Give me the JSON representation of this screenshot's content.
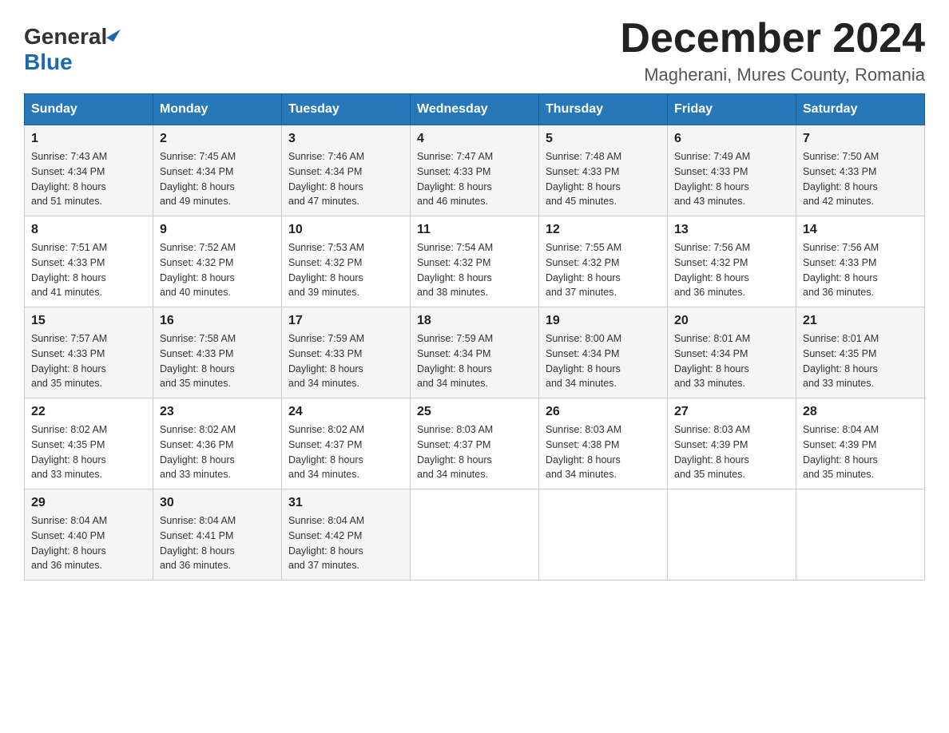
{
  "header": {
    "logo_general": "General",
    "logo_blue": "Blue",
    "month_title": "December 2024",
    "location": "Magherani, Mures County, Romania"
  },
  "days_of_week": [
    "Sunday",
    "Monday",
    "Tuesday",
    "Wednesday",
    "Thursday",
    "Friday",
    "Saturday"
  ],
  "weeks": [
    [
      {
        "day": "1",
        "sunrise": "7:43 AM",
        "sunset": "4:34 PM",
        "daylight": "8 hours and 51 minutes."
      },
      {
        "day": "2",
        "sunrise": "7:45 AM",
        "sunset": "4:34 PM",
        "daylight": "8 hours and 49 minutes."
      },
      {
        "day": "3",
        "sunrise": "7:46 AM",
        "sunset": "4:34 PM",
        "daylight": "8 hours and 47 minutes."
      },
      {
        "day": "4",
        "sunrise": "7:47 AM",
        "sunset": "4:33 PM",
        "daylight": "8 hours and 46 minutes."
      },
      {
        "day": "5",
        "sunrise": "7:48 AM",
        "sunset": "4:33 PM",
        "daylight": "8 hours and 45 minutes."
      },
      {
        "day": "6",
        "sunrise": "7:49 AM",
        "sunset": "4:33 PM",
        "daylight": "8 hours and 43 minutes."
      },
      {
        "day": "7",
        "sunrise": "7:50 AM",
        "sunset": "4:33 PM",
        "daylight": "8 hours and 42 minutes."
      }
    ],
    [
      {
        "day": "8",
        "sunrise": "7:51 AM",
        "sunset": "4:33 PM",
        "daylight": "8 hours and 41 minutes."
      },
      {
        "day": "9",
        "sunrise": "7:52 AM",
        "sunset": "4:32 PM",
        "daylight": "8 hours and 40 minutes."
      },
      {
        "day": "10",
        "sunrise": "7:53 AM",
        "sunset": "4:32 PM",
        "daylight": "8 hours and 39 minutes."
      },
      {
        "day": "11",
        "sunrise": "7:54 AM",
        "sunset": "4:32 PM",
        "daylight": "8 hours and 38 minutes."
      },
      {
        "day": "12",
        "sunrise": "7:55 AM",
        "sunset": "4:32 PM",
        "daylight": "8 hours and 37 minutes."
      },
      {
        "day": "13",
        "sunrise": "7:56 AM",
        "sunset": "4:32 PM",
        "daylight": "8 hours and 36 minutes."
      },
      {
        "day": "14",
        "sunrise": "7:56 AM",
        "sunset": "4:33 PM",
        "daylight": "8 hours and 36 minutes."
      }
    ],
    [
      {
        "day": "15",
        "sunrise": "7:57 AM",
        "sunset": "4:33 PM",
        "daylight": "8 hours and 35 minutes."
      },
      {
        "day": "16",
        "sunrise": "7:58 AM",
        "sunset": "4:33 PM",
        "daylight": "8 hours and 35 minutes."
      },
      {
        "day": "17",
        "sunrise": "7:59 AM",
        "sunset": "4:33 PM",
        "daylight": "8 hours and 34 minutes."
      },
      {
        "day": "18",
        "sunrise": "7:59 AM",
        "sunset": "4:34 PM",
        "daylight": "8 hours and 34 minutes."
      },
      {
        "day": "19",
        "sunrise": "8:00 AM",
        "sunset": "4:34 PM",
        "daylight": "8 hours and 34 minutes."
      },
      {
        "day": "20",
        "sunrise": "8:01 AM",
        "sunset": "4:34 PM",
        "daylight": "8 hours and 33 minutes."
      },
      {
        "day": "21",
        "sunrise": "8:01 AM",
        "sunset": "4:35 PM",
        "daylight": "8 hours and 33 minutes."
      }
    ],
    [
      {
        "day": "22",
        "sunrise": "8:02 AM",
        "sunset": "4:35 PM",
        "daylight": "8 hours and 33 minutes."
      },
      {
        "day": "23",
        "sunrise": "8:02 AM",
        "sunset": "4:36 PM",
        "daylight": "8 hours and 33 minutes."
      },
      {
        "day": "24",
        "sunrise": "8:02 AM",
        "sunset": "4:37 PM",
        "daylight": "8 hours and 34 minutes."
      },
      {
        "day": "25",
        "sunrise": "8:03 AM",
        "sunset": "4:37 PM",
        "daylight": "8 hours and 34 minutes."
      },
      {
        "day": "26",
        "sunrise": "8:03 AM",
        "sunset": "4:38 PM",
        "daylight": "8 hours and 34 minutes."
      },
      {
        "day": "27",
        "sunrise": "8:03 AM",
        "sunset": "4:39 PM",
        "daylight": "8 hours and 35 minutes."
      },
      {
        "day": "28",
        "sunrise": "8:04 AM",
        "sunset": "4:39 PM",
        "daylight": "8 hours and 35 minutes."
      }
    ],
    [
      {
        "day": "29",
        "sunrise": "8:04 AM",
        "sunset": "4:40 PM",
        "daylight": "8 hours and 36 minutes."
      },
      {
        "day": "30",
        "sunrise": "8:04 AM",
        "sunset": "4:41 PM",
        "daylight": "8 hours and 36 minutes."
      },
      {
        "day": "31",
        "sunrise": "8:04 AM",
        "sunset": "4:42 PM",
        "daylight": "8 hours and 37 minutes."
      },
      null,
      null,
      null,
      null
    ]
  ],
  "labels": {
    "sunrise": "Sunrise:",
    "sunset": "Sunset:",
    "daylight": "Daylight:"
  }
}
